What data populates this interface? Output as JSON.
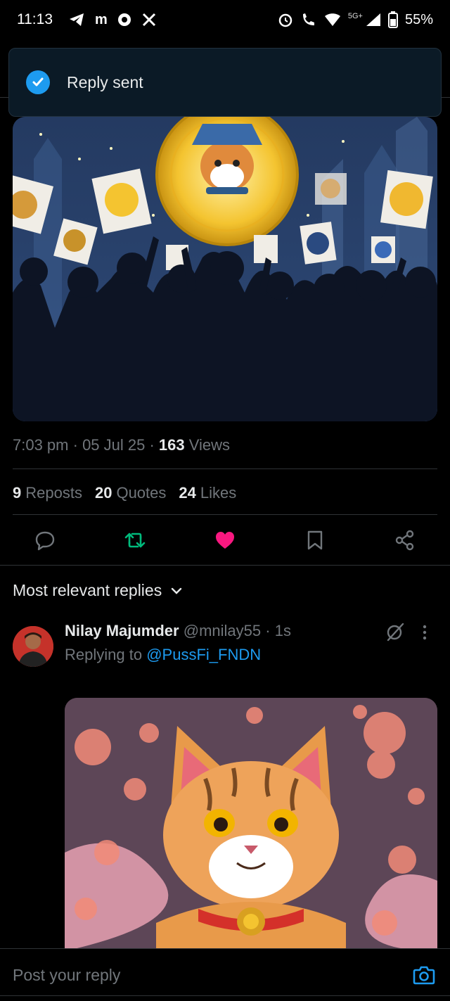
{
  "status": {
    "time": "11:13",
    "network": "5G+",
    "battery": "55%"
  },
  "toast": {
    "text": "Reply sent"
  },
  "post": {
    "time": "7:03 pm",
    "date": "05 Jul 25",
    "views_count": "163",
    "views_label": "Views",
    "reposts_count": "9",
    "reposts_label": "Reposts",
    "quotes_count": "20",
    "quotes_label": "Quotes",
    "likes_count": "24",
    "likes_label": "Likes"
  },
  "sort": {
    "label": "Most relevant replies"
  },
  "reply": {
    "name": "Nilay Majumder",
    "handle": "@mnilay55",
    "time": "1s",
    "replying_prefix": "Replying to",
    "mention": "@PussFi_FNDN"
  },
  "composer": {
    "placeholder": "Post your reply"
  },
  "colors": {
    "accent": "#1d9bf0",
    "repost": "#00ba7c",
    "like": "#f91880",
    "background": "#000000"
  },
  "icons": [
    "reply-icon",
    "repost-icon",
    "like-icon",
    "bookmark-icon",
    "share-icon",
    "check-icon",
    "camera-icon",
    "grok-icon",
    "more-icon"
  ]
}
